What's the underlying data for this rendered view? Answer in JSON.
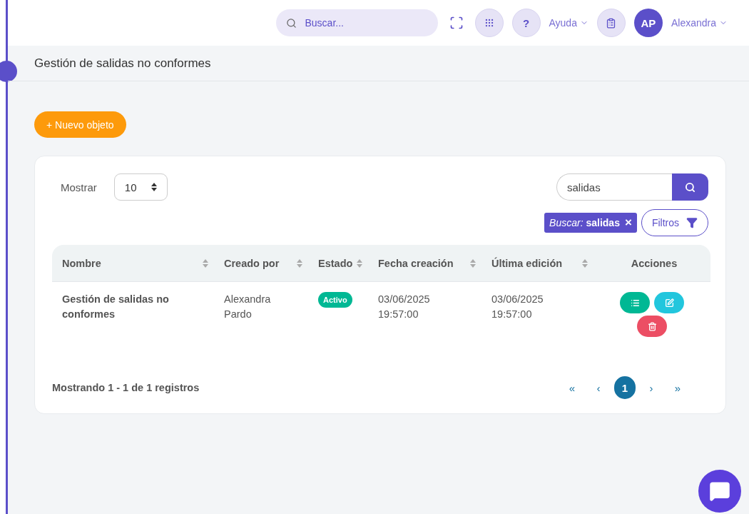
{
  "header": {
    "search": {
      "placeholder": "Buscar..."
    },
    "help_button": "?",
    "help_label": "Ayuda",
    "user": {
      "initials": "AP",
      "name": "Alexandra"
    }
  },
  "page_title": "Gestión de salidas no conformes",
  "new_button": "+ Nuevo objeto",
  "table_controls": {
    "length_label": "Mostrar",
    "length_value": "10",
    "search_value": "salidas",
    "filter_chip": "*Buscar:* **salidas**",
    "filter_chip_close": "×",
    "filters_button": "Filtros"
  },
  "table": {
    "columns": [
      {
        "label": "Nombre",
        "sortable": true
      },
      {
        "label": "Creado por",
        "sortable": true
      },
      {
        "label": "Estado",
        "sortable": true
      },
      {
        "label": "Fecha creación",
        "sortable": true
      },
      {
        "label": "Última edición",
        "sortable": true
      },
      {
        "label": "Acciones",
        "sortable": false
      }
    ],
    "rows": [
      {
        "name": "Gestión de salidas no conformes",
        "created_by": "Alexandra Pardo",
        "status": "Activo",
        "created": "03/06/2025 19:57:00",
        "edited": "03/06/2025 19:57:00",
        "actions": [
          {
            "kind": "list"
          },
          {
            "kind": "edit"
          },
          {
            "kind": "delete"
          }
        ]
      }
    ]
  },
  "info": "Mostrando 1 - 1 de 1 registros",
  "pagination": [
    {
      "label": "«",
      "selected": false
    },
    {
      "label": "‹",
      "selected": false
    },
    {
      "label": "1",
      "selected": true
    },
    {
      "label": "›",
      "selected": false
    },
    {
      "label": "»",
      "selected": false
    }
  ]
}
